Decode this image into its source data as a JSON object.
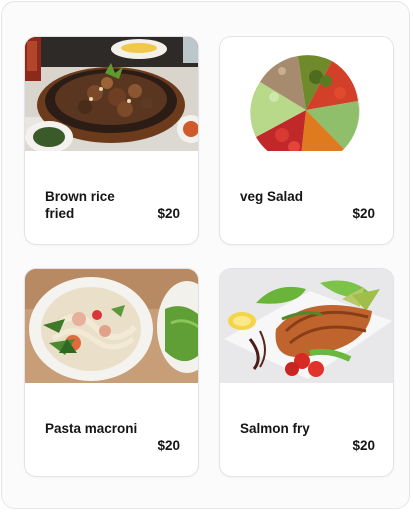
{
  "menu": {
    "items": [
      {
        "name": "Brown rice fried",
        "price": "$20",
        "image": "brown-rice-fried-photo"
      },
      {
        "name": "veg Salad",
        "price": "$20",
        "image": "veg-salad-photo"
      },
      {
        "name": "Pasta macroni",
        "price": "$20",
        "image": "pasta-macroni-photo"
      },
      {
        "name": "Salmon fry",
        "price": "$20",
        "image": "salmon-fry-photo"
      }
    ]
  }
}
